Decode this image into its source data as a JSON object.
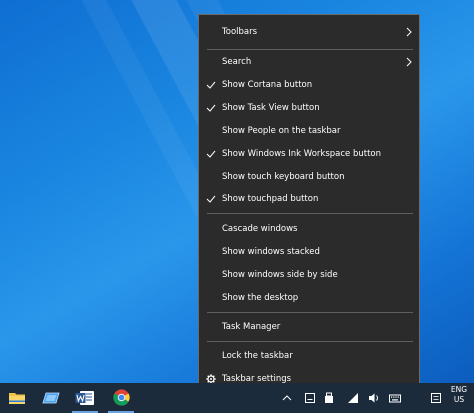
{
  "context_menu": {
    "items": [
      {
        "label": "Toolbars",
        "checked": false,
        "submenu": true
      },
      {
        "label": "Search",
        "checked": false,
        "submenu": true
      },
      {
        "label": "Show Cortana button",
        "checked": true,
        "submenu": false
      },
      {
        "label": "Show Task View button",
        "checked": true,
        "submenu": false
      },
      {
        "label": "Show People on the taskbar",
        "checked": false,
        "submenu": false
      },
      {
        "label": "Show Windows Ink Workspace button",
        "checked": true,
        "submenu": false
      },
      {
        "label": "Show touch keyboard button",
        "checked": false,
        "submenu": false
      },
      {
        "label": "Show touchpad button",
        "checked": true,
        "submenu": false
      },
      {
        "label": "Cascade windows",
        "checked": false,
        "submenu": false
      },
      {
        "label": "Show windows stacked",
        "checked": false,
        "submenu": false
      },
      {
        "label": "Show windows side by side",
        "checked": false,
        "submenu": false
      },
      {
        "label": "Show the desktop",
        "checked": false,
        "submenu": false
      },
      {
        "label": "Task Manager",
        "checked": false,
        "submenu": false
      },
      {
        "label": "Lock the taskbar",
        "checked": false,
        "submenu": false
      },
      {
        "label": "Taskbar settings",
        "icon": "gear-icon",
        "checked": false,
        "submenu": false
      }
    ]
  },
  "taskbar": {
    "apps": [
      {
        "name": "file-explorer",
        "icon": "folder-icon"
      },
      {
        "name": "tablet-app",
        "icon": "tablet-icon"
      },
      {
        "name": "word",
        "icon": "word-icon"
      },
      {
        "name": "chrome",
        "icon": "chrome-icon"
      }
    ],
    "tray_icons": [
      "chevron-up-icon",
      "action-center-icon",
      "usb-icon",
      "network-icon",
      "volume-icon",
      "keyboard-icon",
      "notification-icon"
    ],
    "language_primary": "ENG",
    "language_secondary": "US"
  },
  "colors": {
    "menu_background": "#2b2b2b",
    "menu_border": "#6b6b6b",
    "separator": "#5e5e5e",
    "taskbar": "#1c2b3c",
    "desktop_accent": "#1a86e0"
  }
}
